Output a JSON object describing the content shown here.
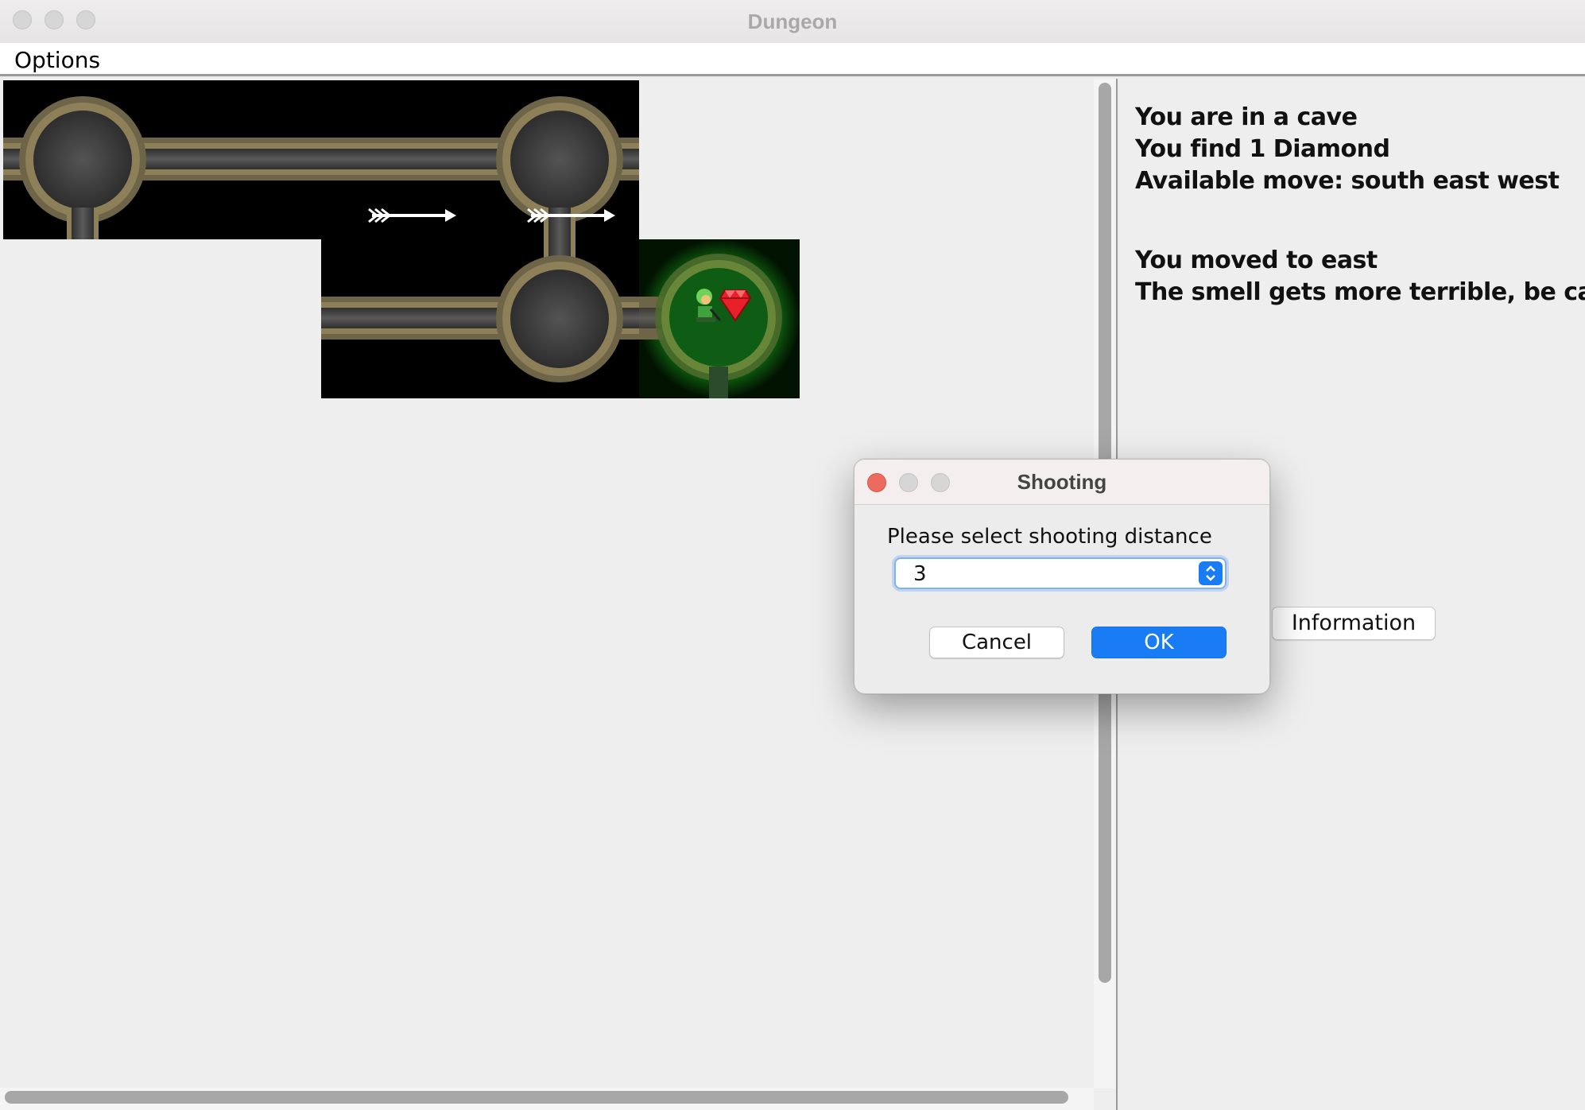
{
  "window": {
    "title": "Dungeon"
  },
  "menu": {
    "items": [
      {
        "label": "Options"
      }
    ]
  },
  "info": {
    "lines_top": [
      "You are in a cave",
      "You find 1 Diamond",
      "Available move: south east west"
    ],
    "lines_bottom": [
      "You moved to east",
      "The smell gets more terrible, be careful"
    ],
    "button_label": "Information"
  },
  "dialog": {
    "title": "Shooting",
    "prompt": "Please select shooting distance",
    "selected_distance": "3",
    "cancel_label": "Cancel",
    "ok_label": "OK"
  },
  "map": {
    "tiles": [
      "cave",
      "tunnel",
      "tunnel",
      "cave",
      "tunnel",
      "cave",
      "cave-player"
    ],
    "items": [
      "arrow",
      "arrow",
      "diamond"
    ],
    "player_location": "cave with diamond",
    "smell": "strong"
  },
  "colors": {
    "accent": "#1a7cf5",
    "close_red": "#ed6a5e",
    "smell_green": "#1fbf1f"
  }
}
